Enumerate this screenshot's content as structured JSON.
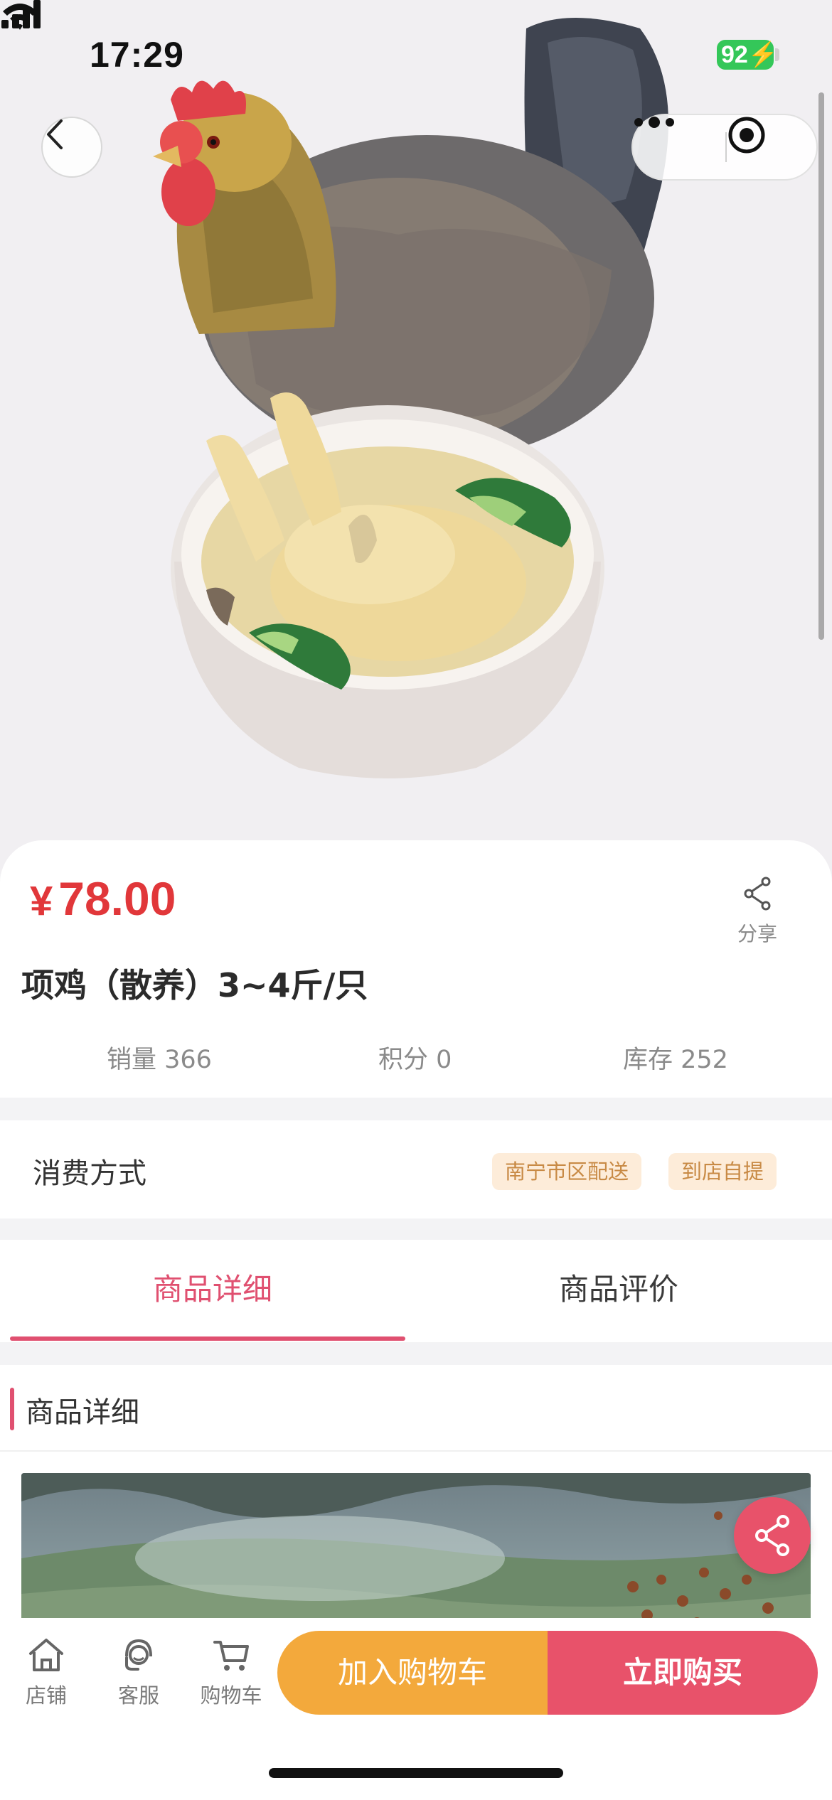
{
  "status_bar": {
    "time": "17:29",
    "battery": "92"
  },
  "icons": {
    "back": "chevron-left-icon",
    "more": "more-dots-icon",
    "close": "target-circle-icon",
    "share": "share-icon",
    "store": "store-icon",
    "service": "customer-service-icon",
    "cart": "cart-icon"
  },
  "product": {
    "price_symbol": "¥",
    "price": "78.00",
    "share_label": "分享",
    "title": "项鸡（散养）3~4斤/只",
    "stats": {
      "sales": "销量 366",
      "points": "积分 0",
      "stock": "库存 252"
    }
  },
  "consumption": {
    "label": "消费方式",
    "tags": [
      "南宁市区配送",
      "到店自提"
    ]
  },
  "tabs": {
    "items": [
      {
        "label": "商品详细",
        "active": true
      },
      {
        "label": "商品评价",
        "active": false
      }
    ]
  },
  "detail": {
    "section_title": "商品详细"
  },
  "bottom_bar": {
    "nav": [
      {
        "label": "店铺",
        "icon": "store-icon"
      },
      {
        "label": "客服",
        "icon": "customer-service-icon"
      },
      {
        "label": "购物车",
        "icon": "cart-icon"
      }
    ],
    "add_to_cart": "加入购物车",
    "buy_now": "立即购买"
  },
  "colors": {
    "price": "#e1373a",
    "accent_pink": "#e05070",
    "add_cart_orange": "#f3a93c",
    "buy_now_red": "#e8526a",
    "tag_bg": "#fdecd9",
    "tag_text": "#c88a45"
  }
}
